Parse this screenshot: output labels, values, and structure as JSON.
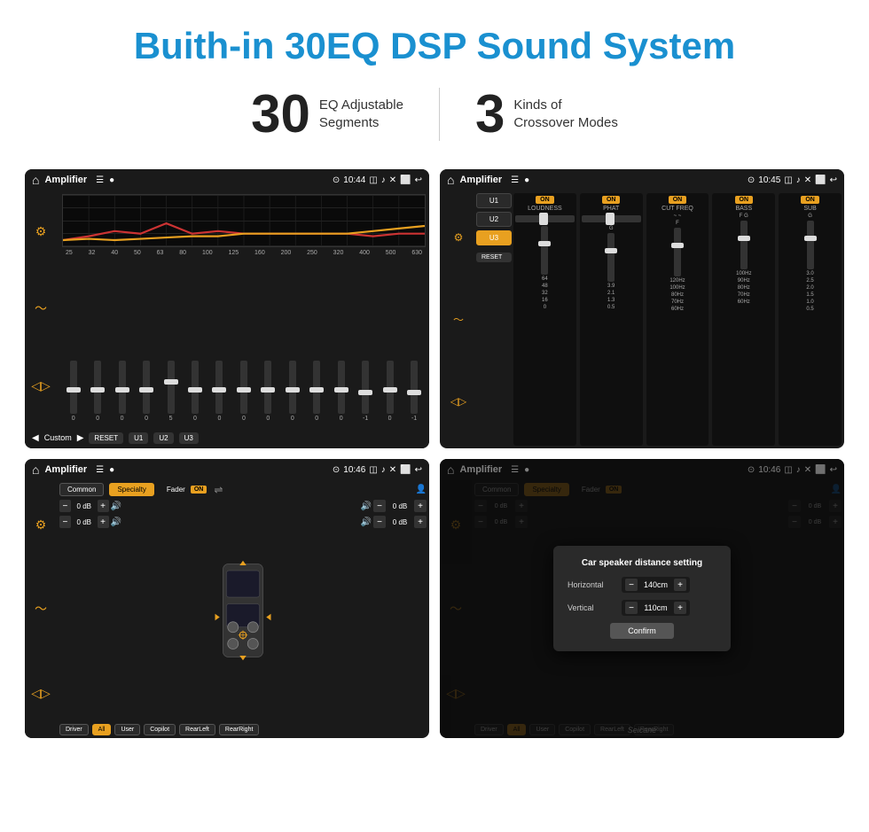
{
  "page": {
    "title": "Buith-in 30EQ DSP Sound System",
    "stat1_number": "30",
    "stat1_label_line1": "EQ Adjustable",
    "stat1_label_line2": "Segments",
    "stat2_number": "3",
    "stat2_label_line1": "Kinds of",
    "stat2_label_line2": "Crossover Modes"
  },
  "screen1": {
    "title": "Amplifier",
    "time": "10:44",
    "eq_labels": [
      "25",
      "32",
      "40",
      "50",
      "63",
      "80",
      "100",
      "125",
      "160",
      "200",
      "250",
      "320",
      "400",
      "500",
      "630"
    ],
    "eq_values": [
      "0",
      "0",
      "0",
      "0",
      "5",
      "0",
      "0",
      "0",
      "0",
      "0",
      "0",
      "0",
      "-1",
      "0",
      "-1"
    ],
    "bottom_label": "Custom",
    "buttons": [
      "RESET",
      "U1",
      "U2",
      "U3"
    ]
  },
  "screen2": {
    "title": "Amplifier",
    "time": "10:45",
    "presets": [
      "U1",
      "U2",
      "U3"
    ],
    "active_preset": "U3",
    "bands": [
      "LOUDNESS",
      "PHAT",
      "CUT FREQ",
      "BASS",
      "SUB"
    ],
    "band_on_states": [
      true,
      true,
      true,
      true,
      true
    ],
    "reset_label": "RESET"
  },
  "screen3": {
    "title": "Amplifier",
    "time": "10:46",
    "top_buttons": [
      "Common",
      "Specialty"
    ],
    "active_top": "Specialty",
    "fader_label": "Fader",
    "fader_on": "ON",
    "db_values": [
      "0 dB",
      "0 dB",
      "0 dB",
      "0 dB"
    ],
    "bottom_buttons": [
      "Driver",
      "RearLeft",
      "All",
      "User",
      "Copilot",
      "RearRight"
    ],
    "active_bottom": "All"
  },
  "screen4": {
    "title": "Amplifier",
    "time": "10:46",
    "top_buttons": [
      "Common",
      "Specialty"
    ],
    "dialog_title": "Car speaker distance setting",
    "horizontal_label": "Horizontal",
    "horizontal_value": "140cm",
    "vertical_label": "Vertical",
    "vertical_value": "110cm",
    "confirm_label": "Confirm",
    "db_values": [
      "0 dB",
      "0 dB"
    ],
    "bottom_buttons": [
      "Driver",
      "RearLeft",
      "All",
      "User",
      "Copilot",
      "RearRight"
    ]
  },
  "watermark": "Seicane"
}
